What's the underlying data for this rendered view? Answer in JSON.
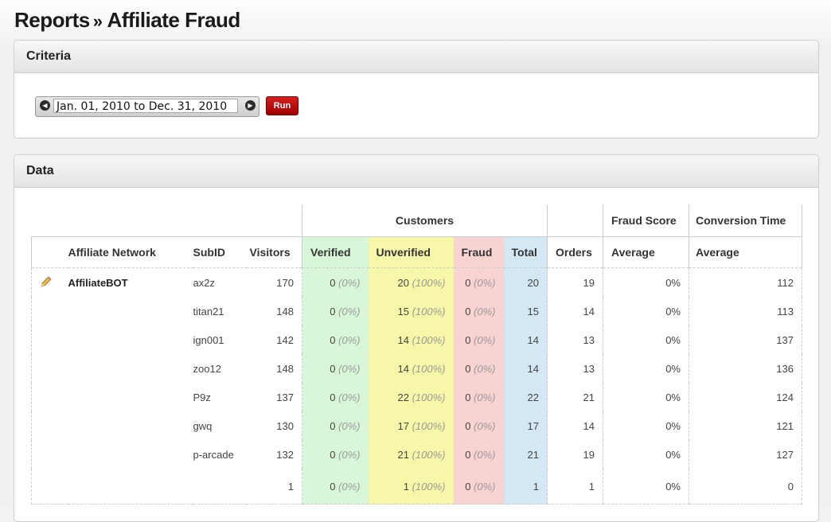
{
  "page": {
    "title_part1": "Reports",
    "title_sep": "»",
    "title_part2": "Affiliate Fraud"
  },
  "criteria": {
    "heading": "Criteria",
    "date_range": "Jan. 01, 2010 to Dec. 31, 2010",
    "run_label": "Run"
  },
  "data": {
    "heading": "Data",
    "group_headers": {
      "customers": "Customers",
      "fraud_score": "Fraud Score",
      "conversion_time": "Conversion Time"
    },
    "columns": {
      "network": "Affiliate Network",
      "subid": "SubID",
      "visitors": "Visitors",
      "verified": "Verified",
      "unverified": "Unverified",
      "fraud": "Fraud",
      "total": "Total",
      "orders": "Orders",
      "fraud_avg": "Average",
      "conv_avg": "Average"
    },
    "network_name": "AffiliateBOT",
    "rows": [
      {
        "subid": "ax2z",
        "visitors": "170",
        "verified": "0",
        "verified_pct": "(0%)",
        "unverified": "20",
        "unverified_pct": "(100%)",
        "fraud": "0",
        "fraud_pct": "(0%)",
        "total": "20",
        "orders": "19",
        "fraud_score": "0%",
        "conv_time": "112"
      },
      {
        "subid": "titan21",
        "visitors": "148",
        "verified": "0",
        "verified_pct": "(0%)",
        "unverified": "15",
        "unverified_pct": "(100%)",
        "fraud": "0",
        "fraud_pct": "(0%)",
        "total": "15",
        "orders": "14",
        "fraud_score": "0%",
        "conv_time": "113"
      },
      {
        "subid": "ign001",
        "visitors": "142",
        "verified": "0",
        "verified_pct": "(0%)",
        "unverified": "14",
        "unverified_pct": "(100%)",
        "fraud": "0",
        "fraud_pct": "(0%)",
        "total": "14",
        "orders": "13",
        "fraud_score": "0%",
        "conv_time": "137"
      },
      {
        "subid": "zoo12",
        "visitors": "148",
        "verified": "0",
        "verified_pct": "(0%)",
        "unverified": "14",
        "unverified_pct": "(100%)",
        "fraud": "0",
        "fraud_pct": "(0%)",
        "total": "14",
        "orders": "13",
        "fraud_score": "0%",
        "conv_time": "136"
      },
      {
        "subid": "P9z",
        "visitors": "137",
        "verified": "0",
        "verified_pct": "(0%)",
        "unverified": "22",
        "unverified_pct": "(100%)",
        "fraud": "0",
        "fraud_pct": "(0%)",
        "total": "22",
        "orders": "21",
        "fraud_score": "0%",
        "conv_time": "124"
      },
      {
        "subid": "gwq",
        "visitors": "130",
        "verified": "0",
        "verified_pct": "(0%)",
        "unverified": "17",
        "unverified_pct": "(100%)",
        "fraud": "0",
        "fraud_pct": "(0%)",
        "total": "17",
        "orders": "14",
        "fraud_score": "0%",
        "conv_time": "121"
      },
      {
        "subid": "p-arcade",
        "visitors": "132",
        "verified": "0",
        "verified_pct": "(0%)",
        "unverified": "21",
        "unverified_pct": "(100%)",
        "fraud": "0",
        "fraud_pct": "(0%)",
        "total": "21",
        "orders": "19",
        "fraud_score": "0%",
        "conv_time": "127"
      },
      {
        "subid": "",
        "visitors": "1",
        "verified": "0",
        "verified_pct": "(0%)",
        "unverified": "1",
        "unverified_pct": "(100%)",
        "fraud": "0",
        "fraud_pct": "(0%)",
        "total": "1",
        "orders": "1",
        "fraud_score": "0%",
        "conv_time": "0"
      }
    ],
    "icons": {
      "edit": "pencil-icon",
      "prev": "chevron-left-icon",
      "next": "chevron-right-icon"
    },
    "colors": {
      "verified": "#d8f6d8",
      "unverified": "#f6f7a8",
      "fraud": "#f7d3d1",
      "total": "#d3e8f3",
      "run_button": "#c00000"
    }
  }
}
